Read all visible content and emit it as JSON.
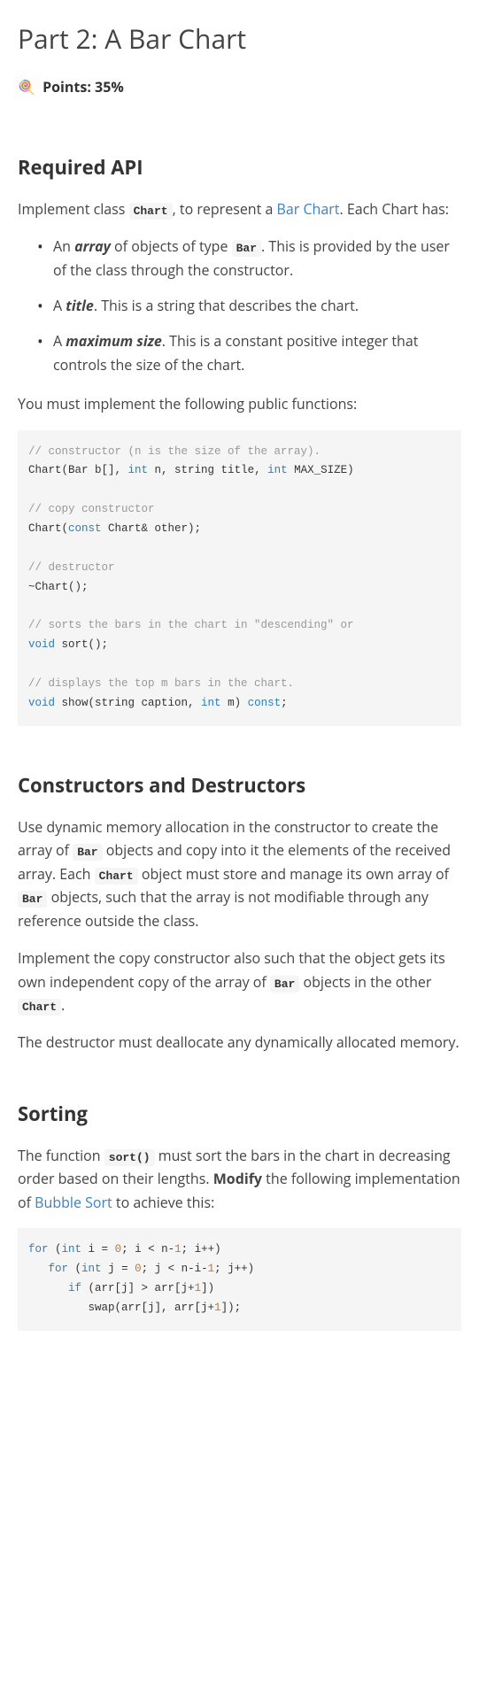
{
  "title": "Part 2: A Bar Chart",
  "points_emoji": "🍭",
  "points_text": "Points: 35%",
  "sections": {
    "required_api": {
      "heading": "Required API",
      "intro_pre": "Implement class ",
      "intro_code": "Chart",
      "intro_mid": ", to represent a ",
      "intro_link": "Bar Chart",
      "intro_post": ". Each Chart has:",
      "bullets": {
        "b1_pre": "An ",
        "b1_em": "array",
        "b1_mid": " of objects of type ",
        "b1_code": "Bar",
        "b1_post": ". This is provided by the user of the class through the constructor.",
        "b2_pre": "A ",
        "b2_em": "title",
        "b2_post": ". This is a string that describes the chart.",
        "b3_pre": "A ",
        "b3_em": "maximum size",
        "b3_post": ". This is a constant positive integer that controls the size of the chart."
      },
      "para2": "You must implement the following public functions:",
      "code": {
        "c1": "// constructor (n is the size of the array).",
        "c2a": "Chart(Bar b[], ",
        "c2b": "int",
        "c2c": " n, string title, ",
        "c2d": "int",
        "c2e": " MAX_SIZE)",
        "c3": "// copy constructor",
        "c4a": "Chart(",
        "c4b": "const",
        "c4c": " Chart& other);",
        "c5": "// destructor",
        "c6": "~Chart();",
        "c7": "// sorts the bars in the chart in \"descending\" or",
        "c8a": "void",
        "c8b": " sort();",
        "c9": "// displays the top m bars in the chart.",
        "c10a": "void",
        "c10b": " show(string caption, ",
        "c10c": "int",
        "c10d": " m) ",
        "c10e": "const",
        "c10f": ";"
      }
    },
    "constructors": {
      "heading": "Constructors and Destructors",
      "p1_pre": "Use dynamic memory allocation in the constructor to create the array of ",
      "p1_code1": "Bar",
      "p1_mid1": " objects and copy into it the elements of the received array. Each ",
      "p1_code2": "Chart",
      "p1_mid2": " object must store and manage its own array of ",
      "p1_code3": "Bar",
      "p1_post": " objects, such that the array is not modifiable through any reference outside the class.",
      "p2_pre": "Implement the copy constructor also such that the object gets its own independent copy of the array of ",
      "p2_code1": "Bar",
      "p2_mid": " objects in the other ",
      "p2_code2": "Chart",
      "p2_post": ".",
      "p3": "The destructor must deallocate any dynamically allocated memory."
    },
    "sorting": {
      "heading": "Sorting",
      "p1_pre": "The function ",
      "p1_code": "sort()",
      "p1_mid": " must sort the bars in the chart in decreasing order based on their lengths. ",
      "p1_bold": "Modify",
      "p1_mid2": " the following implementation of ",
      "p1_link": "Bubble Sort",
      "p1_post": " to achieve this:",
      "code": {
        "l1a": "for",
        "l1b": " (",
        "l1c": "int",
        "l1d": " i = ",
        "l1e": "0",
        "l1f": "; i < n-",
        "l1g": "1",
        "l1h": "; i++)",
        "l2a": "for",
        "l2b": " (",
        "l2c": "int",
        "l2d": " j = ",
        "l2e": "0",
        "l2f": "; j < n-i-",
        "l2g": "1",
        "l2h": "; j++)",
        "l3a": "if",
        "l3b": " (arr[j] > arr[j+",
        "l3c": "1",
        "l3d": "])",
        "l4a": "swap(arr[j], arr[j+",
        "l4b": "1",
        "l4c": "]);"
      }
    }
  }
}
